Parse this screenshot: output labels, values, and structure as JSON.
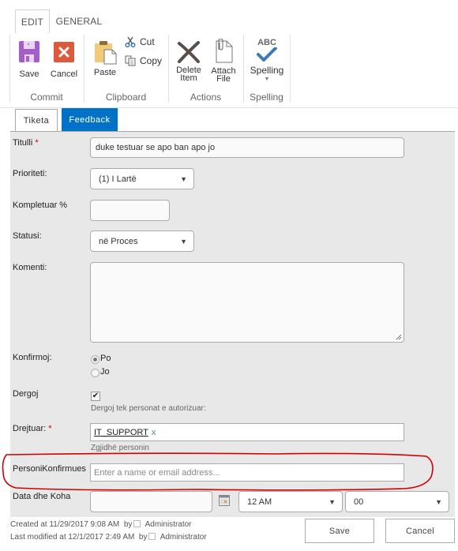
{
  "ribbon": {
    "tabs": [
      {
        "label": "EDIT",
        "active": true
      },
      {
        "label": "GENERAL",
        "active": false
      }
    ],
    "groups": [
      {
        "label": "Commit",
        "buttons": [
          {
            "label": "Save",
            "icon": "save-icon"
          },
          {
            "label": "Cancel",
            "icon": "cancel-icon"
          }
        ]
      },
      {
        "label": "Clipboard",
        "buttons": [
          {
            "label": "Paste",
            "icon": "paste-icon"
          },
          {
            "label": "Cut",
            "icon": "cut-icon"
          },
          {
            "label": "Copy",
            "icon": "copy-icon"
          }
        ]
      },
      {
        "label": "Actions",
        "buttons": [
          {
            "label_line1": "Delete",
            "label_line2": "Item",
            "icon": "delete-icon"
          },
          {
            "label_line1": "Attach",
            "label_line2": "File",
            "icon": "attach-icon"
          }
        ]
      },
      {
        "label": "Spelling",
        "buttons": [
          {
            "label": "Spelling",
            "icon": "spelling-icon",
            "icon_text": "ABC"
          }
        ]
      }
    ]
  },
  "form_tabs": [
    {
      "label": "Tiketa",
      "active": false
    },
    {
      "label": "Feedback",
      "active": true
    }
  ],
  "form": {
    "titulli": {
      "label": "Titulli",
      "required_mark": "*",
      "value": "duke testuar se apo ban apo jo"
    },
    "prioriteti": {
      "label": "Prioriteti:",
      "value": "(1) I Lartë"
    },
    "kompletuar": {
      "label": "Kompletuar %",
      "value": ""
    },
    "statusi": {
      "label": "Statusi:",
      "value": "në Proces"
    },
    "komenti": {
      "label": "Komenti:",
      "value": ""
    },
    "konfirmoj": {
      "label": "Konfirmoj:",
      "options": [
        {
          "label": "Po",
          "selected": true
        },
        {
          "label": "Jo",
          "selected": false
        }
      ]
    },
    "dergoj": {
      "label": "Dergoj",
      "checked": true,
      "hint": "Dergoj tek personat e autorizuar:"
    },
    "drejtuar": {
      "label": "Drejtuar:",
      "required_mark": "*",
      "value": "IT_SUPPORT",
      "remove": "x",
      "hint": "Zgjidhë personin"
    },
    "personi_konfirmues": {
      "label": "PersoniKonfirmues",
      "placeholder": "Enter a name or email address..."
    },
    "data_dhe_koha": {
      "label": "Data dhe Koha",
      "date_value": "",
      "hour": "12 AM",
      "minute": "00"
    }
  },
  "footer": {
    "created": "Created at 11/29/2017 9:08 AM",
    "modified": "Last modified at 12/1/2017 2:49 AM",
    "by": "by",
    "author": "Administrator",
    "save_label": "Save",
    "cancel_label": "Cancel"
  },
  "colors": {
    "accent": "#0072c6",
    "annotation": "#d40000",
    "form_bg": "#e8e8e8"
  }
}
